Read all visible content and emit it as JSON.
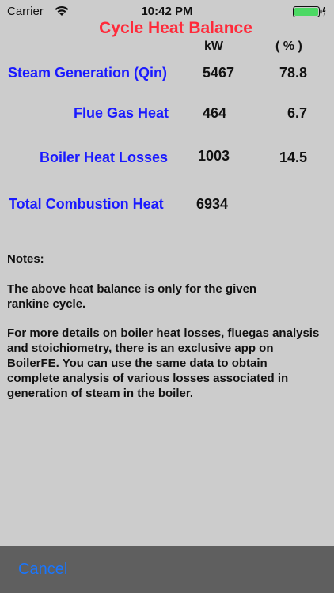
{
  "status_bar": {
    "carrier": "Carrier",
    "time": "10:42 PM"
  },
  "title": "Cycle Heat Balance",
  "columns": {
    "kw": "kW",
    "percent": "( % )"
  },
  "rows": [
    {
      "label": "Steam Generation (Qin)",
      "kw": "5467",
      "percent": "78.8"
    },
    {
      "label": "Flue Gas Heat",
      "kw": "464",
      "percent": "6.7"
    },
    {
      "label": "Boiler Heat Losses",
      "kw": "1003",
      "percent": "14.5"
    },
    {
      "label": "Total Combustion Heat",
      "kw": "6934",
      "percent": ""
    }
  ],
  "notes": {
    "heading": "Notes:",
    "paragraph1": "The above heat balance is only for the given rankine cycle.",
    "paragraph2": "For more details on boiler heat losses, fluegas analysis and stoichiometry, there is an exclusive app on BoilerFE.  You can use the same data to obtain complete analysis of various losses associated in generation of steam in the boiler."
  },
  "footer": {
    "cancel_label": "Cancel"
  },
  "colors": {
    "title": "#ff2a3a",
    "row_label": "#1a1aff",
    "cancel": "#1976ff",
    "battery": "#4cd964"
  },
  "icons": [
    "wifi-icon",
    "battery-icon",
    "charging-icon"
  ]
}
